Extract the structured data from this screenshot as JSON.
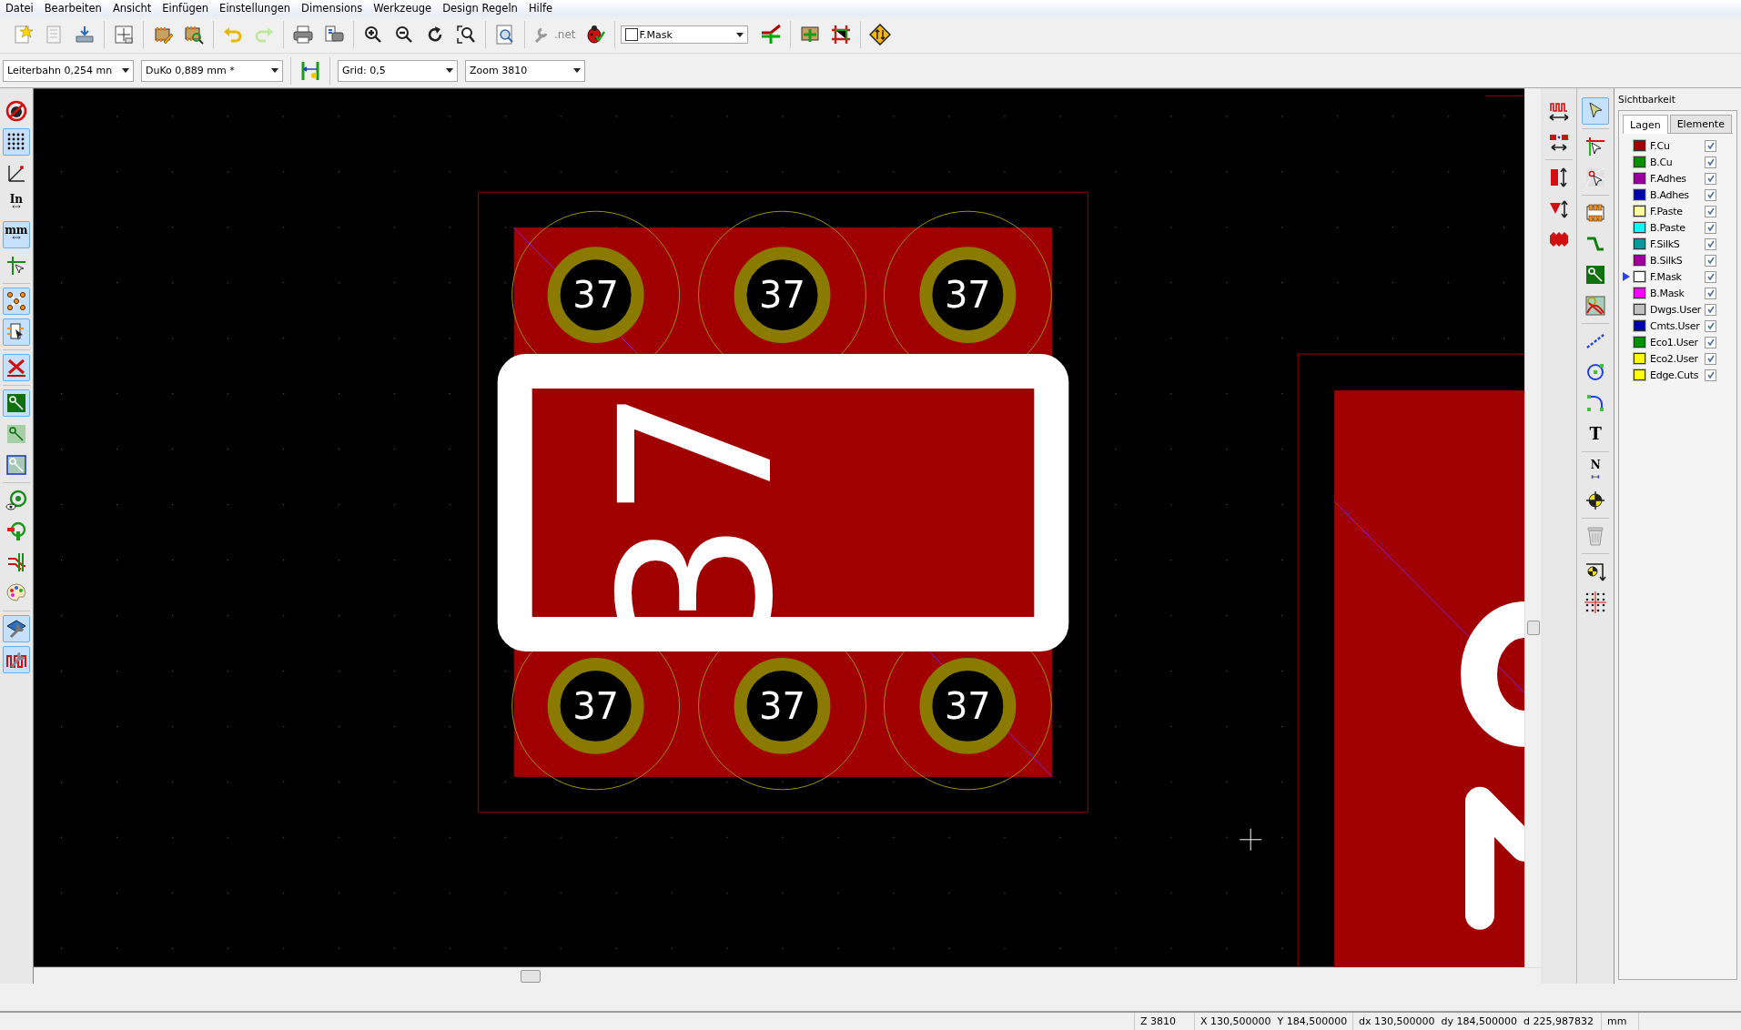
{
  "menu": [
    "Datei",
    "Bearbeiten",
    "Ansicht",
    "Einfügen",
    "Einstellungen",
    "Dimensions",
    "Werkzeuge",
    "Design Regeln",
    "Hilfe"
  ],
  "top_toolbar": [
    [
      {
        "kind": "new"
      },
      {
        "kind": "save"
      },
      {
        "kind": "load"
      }
    ],
    [
      {
        "kind": "page"
      }
    ],
    [
      {
        "kind": "module-editor"
      },
      {
        "kind": "module-viewer"
      }
    ],
    [
      {
        "kind": "undo"
      },
      {
        "kind": "redo"
      }
    ],
    [
      {
        "kind": "print"
      },
      {
        "kind": "plot"
      }
    ],
    [
      {
        "kind": "zoom-in"
      },
      {
        "kind": "zoom-out"
      },
      {
        "kind": "redraw"
      },
      {
        "kind": "zoom-fit"
      }
    ],
    [
      {
        "kind": "find"
      }
    ],
    [
      {
        "kind": "netlist",
        "label": ".net"
      },
      {
        "kind": "drc"
      }
    ],
    [
      {
        "kind": "layer-combo",
        "value": "F.Mask"
      },
      {
        "kind": "layer-pair"
      }
    ],
    [
      {
        "kind": "autoplace"
      },
      {
        "kind": "route"
      }
    ],
    [
      {
        "kind": "script"
      }
    ]
  ],
  "aux_toolbar": [
    {
      "kind": "combo",
      "value": "Leiterbahn 0,254 mn"
    },
    {
      "kind": "combo",
      "value": "DuKo 0,889 mm *"
    },
    {
      "kind": "track-width"
    },
    {
      "kind": "combo",
      "value": "Grid: 0,5"
    },
    {
      "kind": "combo",
      "value": "Zoom 3810"
    }
  ],
  "left_toolbar": [
    [
      {
        "kind": "drc-off",
        "selected": false
      },
      {
        "kind": "grid",
        "selected": true
      },
      {
        "kind": "polar",
        "selected": false
      },
      {
        "kind": "units",
        "label": "In",
        "selected": false
      },
      {
        "kind": "units",
        "label": "mm",
        "selected": true
      },
      {
        "kind": "cursor",
        "selected": false
      }
    ],
    [
      {
        "kind": "ratsnest",
        "selected": true
      },
      {
        "kind": "module-ratsnest",
        "selected": true
      }
    ],
    [
      {
        "kind": "autodelete",
        "selected": true
      }
    ],
    [
      {
        "kind": "zone-fill",
        "selected": true
      },
      {
        "kind": "zone-sketch",
        "selected": false
      },
      {
        "kind": "zone-outline",
        "selected": false
      }
    ],
    [
      {
        "kind": "contrast",
        "selected": false
      },
      {
        "kind": "net-hilite",
        "selected": false
      },
      {
        "kind": "tracks",
        "selected": false
      },
      {
        "kind": "palette",
        "selected": false
      }
    ],
    [
      {
        "kind": "layers-manager",
        "selected": true
      },
      {
        "kind": "microwave",
        "selected": true
      }
    ]
  ],
  "microwave_toolbar": [
    [
      {
        "kind": "mw-wave"
      },
      {
        "kind": "mw-gap"
      }
    ],
    [
      {
        "kind": "mw-stub"
      },
      {
        "kind": "mw-fan"
      },
      {
        "kind": "mw-poly"
      }
    ]
  ],
  "right_toolbar": [
    [
      {
        "kind": "select",
        "selected": true
      }
    ],
    [
      {
        "kind": "highlight",
        "selected": false
      },
      {
        "kind": "local-ratsnest",
        "selected": false
      }
    ],
    [
      {
        "kind": "module",
        "selected": false
      },
      {
        "kind": "track",
        "selected": false
      },
      {
        "kind": "zone",
        "selected": false
      },
      {
        "kind": "keepout",
        "selected": false
      }
    ],
    [
      {
        "kind": "line",
        "selected": false
      },
      {
        "kind": "circle",
        "selected": false
      },
      {
        "kind": "arc",
        "selected": false
      },
      {
        "kind": "text",
        "label": "T",
        "selected": false
      }
    ],
    [
      {
        "kind": "dimension",
        "label": "N",
        "selected": false
      },
      {
        "kind": "target",
        "selected": false
      }
    ],
    [
      {
        "kind": "delete",
        "selected": false
      }
    ],
    [
      {
        "kind": "origin",
        "selected": false
      },
      {
        "kind": "grid-origin",
        "selected": false
      }
    ]
  ],
  "board": {
    "pads": [
      {
        "label": "37"
      },
      {
        "label": "37"
      },
      {
        "label": "37"
      },
      {
        "label": "37"
      },
      {
        "label": "37"
      },
      {
        "label": "37"
      }
    ],
    "silkscreen_text": "37"
  },
  "visibility_panel": {
    "title": "Sichtbarkeit",
    "tabs": [
      {
        "label": "Lagen",
        "selected": true
      },
      {
        "label": "Elemente",
        "selected": false
      }
    ],
    "layers": [
      {
        "name": "F.Cu",
        "color": "#a00000",
        "checked": true,
        "selected": false
      },
      {
        "name": "B.Cu",
        "color": "#009000",
        "checked": true,
        "selected": false
      },
      {
        "name": "F.Adhes",
        "color": "#990099",
        "checked": true,
        "selected": false
      },
      {
        "name": "B.Adhes",
        "color": "#0000aa",
        "checked": true,
        "selected": false
      },
      {
        "name": "F.Paste",
        "color": "#ffff99",
        "checked": true,
        "selected": false
      },
      {
        "name": "B.Paste",
        "color": "#00ffff",
        "checked": true,
        "selected": false
      },
      {
        "name": "F.SilkS",
        "color": "#009a9a",
        "checked": true,
        "selected": false
      },
      {
        "name": "B.SilkS",
        "color": "#980098",
        "checked": true,
        "selected": false
      },
      {
        "name": "F.Mask",
        "color": "#ffffff",
        "checked": true,
        "selected": true
      },
      {
        "name": "B.Mask",
        "color": "#ff00ff",
        "checked": true,
        "selected": false
      },
      {
        "name": "Dwgs.User",
        "color": "#c0c0c0",
        "checked": true,
        "selected": false
      },
      {
        "name": "Cmts.User",
        "color": "#0000a9",
        "checked": true,
        "selected": false
      },
      {
        "name": "Eco1.User",
        "color": "#009100",
        "checked": true,
        "selected": false
      },
      {
        "name": "Eco2.User",
        "color": "#fffe00",
        "checked": true,
        "selected": false
      },
      {
        "name": "Edge.Cuts",
        "color": "#feff00",
        "checked": true,
        "selected": false
      }
    ]
  },
  "status_bar": [
    "Z 3810",
    "X 130,500000  Y 184,500000",
    "dx 130,500000  dy 184,500000  d 225,987832",
    "mm"
  ]
}
